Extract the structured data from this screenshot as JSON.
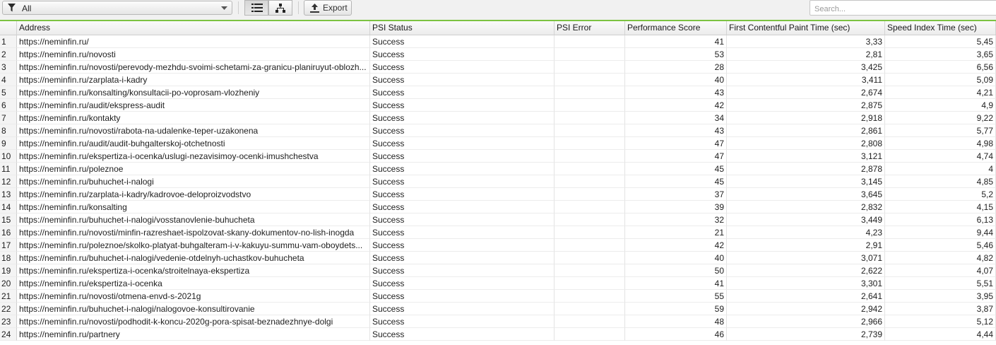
{
  "toolbar": {
    "filter_value": "All",
    "export_label": "Export",
    "search_placeholder": "Search..."
  },
  "columns": [
    "",
    "Address",
    "PSI Status",
    "PSI Error",
    "Performance Score",
    "First Contentful Paint Time (sec)",
    "Speed Index Time (sec)"
  ],
  "rows": [
    [
      "1",
      "https://neminfin.ru/",
      "Success",
      "",
      "41",
      "3,33",
      "5,45"
    ],
    [
      "2",
      "https://neminfin.ru/novosti",
      "Success",
      "",
      "53",
      "2,81",
      "3,65"
    ],
    [
      "3",
      "https://neminfin.ru/novosti/perevody-mezhdu-svoimi-schetami-za-granicu-planiruyut-oblozh...",
      "Success",
      "",
      "28",
      "3,425",
      "6,56"
    ],
    [
      "4",
      "https://neminfin.ru/zarplata-i-kadry",
      "Success",
      "",
      "40",
      "3,411",
      "5,09"
    ],
    [
      "5",
      "https://neminfin.ru/konsalting/konsultacii-po-voprosam-vlozheniy",
      "Success",
      "",
      "43",
      "2,674",
      "4,21"
    ],
    [
      "6",
      "https://neminfin.ru/audit/ekspress-audit",
      "Success",
      "",
      "42",
      "2,875",
      "4,9"
    ],
    [
      "7",
      "https://neminfin.ru/kontakty",
      "Success",
      "",
      "34",
      "2,918",
      "9,22"
    ],
    [
      "8",
      "https://neminfin.ru/novosti/rabota-na-udalenke-teper-uzakonena",
      "Success",
      "",
      "43",
      "2,861",
      "5,77"
    ],
    [
      "9",
      "https://neminfin.ru/audit/audit-buhgalterskoj-otchetnosti",
      "Success",
      "",
      "47",
      "2,808",
      "4,98"
    ],
    [
      "10",
      "https://neminfin.ru/ekspertiza-i-ocenka/uslugi-nezavisimoy-ocenki-imushchestva",
      "Success",
      "",
      "47",
      "3,121",
      "4,74"
    ],
    [
      "11",
      "https://neminfin.ru/poleznoe",
      "Success",
      "",
      "45",
      "2,878",
      "4"
    ],
    [
      "12",
      "https://neminfin.ru/buhuchet-i-nalogi",
      "Success",
      "",
      "45",
      "3,145",
      "4,85"
    ],
    [
      "13",
      "https://neminfin.ru/zarplata-i-kadry/kadrovoe-deloproizvodstvo",
      "Success",
      "",
      "37",
      "3,645",
      "5,2"
    ],
    [
      "14",
      "https://neminfin.ru/konsalting",
      "Success",
      "",
      "39",
      "2,832",
      "4,15"
    ],
    [
      "15",
      "https://neminfin.ru/buhuchet-i-nalogi/vosstanovlenie-buhucheta",
      "Success",
      "",
      "32",
      "3,449",
      "6,13"
    ],
    [
      "16",
      "https://neminfin.ru/novosti/minfin-razreshaet-ispolzovat-skany-dokumentov-no-lish-inogda",
      "Success",
      "",
      "21",
      "4,23",
      "9,44"
    ],
    [
      "17",
      "https://neminfin.ru/poleznoe/skolko-platyat-buhgalteram-i-v-kakuyu-summu-vam-oboydets...",
      "Success",
      "",
      "42",
      "2,91",
      "5,46"
    ],
    [
      "18",
      "https://neminfin.ru/buhuchet-i-nalogi/vedenie-otdelnyh-uchastkov-buhucheta",
      "Success",
      "",
      "40",
      "3,071",
      "4,82"
    ],
    [
      "19",
      "https://neminfin.ru/ekspertiza-i-ocenka/stroitelnaya-ekspertiza",
      "Success",
      "",
      "50",
      "2,622",
      "4,07"
    ],
    [
      "20",
      "https://neminfin.ru/ekspertiza-i-ocenka",
      "Success",
      "",
      "41",
      "3,301",
      "5,51"
    ],
    [
      "21",
      "https://neminfin.ru/novosti/otmena-envd-s-2021g",
      "Success",
      "",
      "55",
      "2,641",
      "3,95"
    ],
    [
      "22",
      "https://neminfin.ru/buhuchet-i-nalogi/nalogovoe-konsultirovanie",
      "Success",
      "",
      "59",
      "2,942",
      "3,87"
    ],
    [
      "23",
      "https://neminfin.ru/novosti/podhodit-k-koncu-2020g-pora-spisat-beznadezhnye-dolgi",
      "Success",
      "",
      "48",
      "2,966",
      "5,12"
    ],
    [
      "24",
      "https://neminfin.ru/partnery",
      "Success",
      "",
      "46",
      "2,739",
      "4,44"
    ]
  ]
}
